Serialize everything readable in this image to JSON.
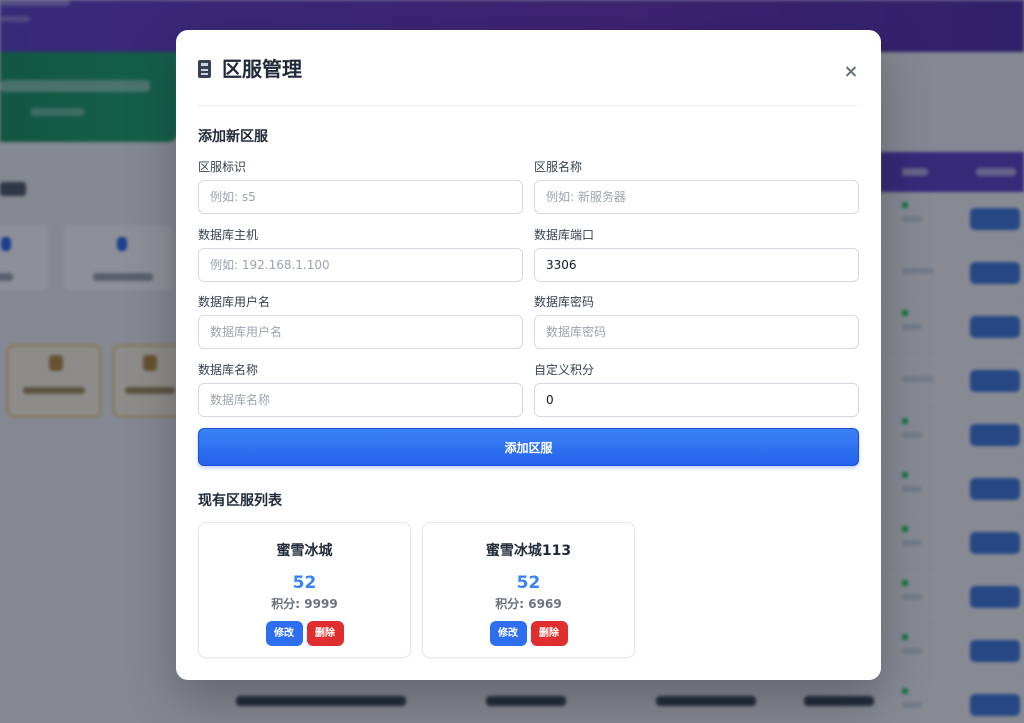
{
  "modal": {
    "title": "区服管理",
    "title_icon": "server-icon",
    "close_icon": "close-icon"
  },
  "add_section": {
    "heading": "添加新区服",
    "fields": [
      {
        "label": "区服标识",
        "value": "",
        "placeholder": "例如: s5"
      },
      {
        "label": "区服名称",
        "value": "",
        "placeholder": "例如: 新服务器"
      },
      {
        "label": "数据库主机",
        "value": "",
        "placeholder": "例如: 192.168.1.100"
      },
      {
        "label": "数据库端口",
        "value": "3306",
        "placeholder": ""
      },
      {
        "label": "数据库用户名",
        "value": "",
        "placeholder": "数据库用户名"
      },
      {
        "label": "数据库密码",
        "value": "",
        "placeholder": "数据库密码"
      },
      {
        "label": "数据库名称",
        "value": "",
        "placeholder": "数据库名称"
      },
      {
        "label": "自定义积分",
        "value": "0",
        "placeholder": ""
      }
    ],
    "submit_label": "添加区服"
  },
  "list_section": {
    "heading": "现有区服列表",
    "servers": [
      {
        "name": "蜜雪冰城",
        "count": "52",
        "score": "积分: 9999",
        "edit_label": "修改",
        "delete_label": "删除"
      },
      {
        "name": "蜜雪冰城113",
        "count": "52",
        "score": "积分: 6969",
        "edit_label": "修改",
        "delete_label": "删除"
      }
    ]
  },
  "colors": {
    "primary": "#3b82f6",
    "danger": "#e02d2d",
    "header_purple": "#5b3cc4",
    "green": "#14915a"
  }
}
